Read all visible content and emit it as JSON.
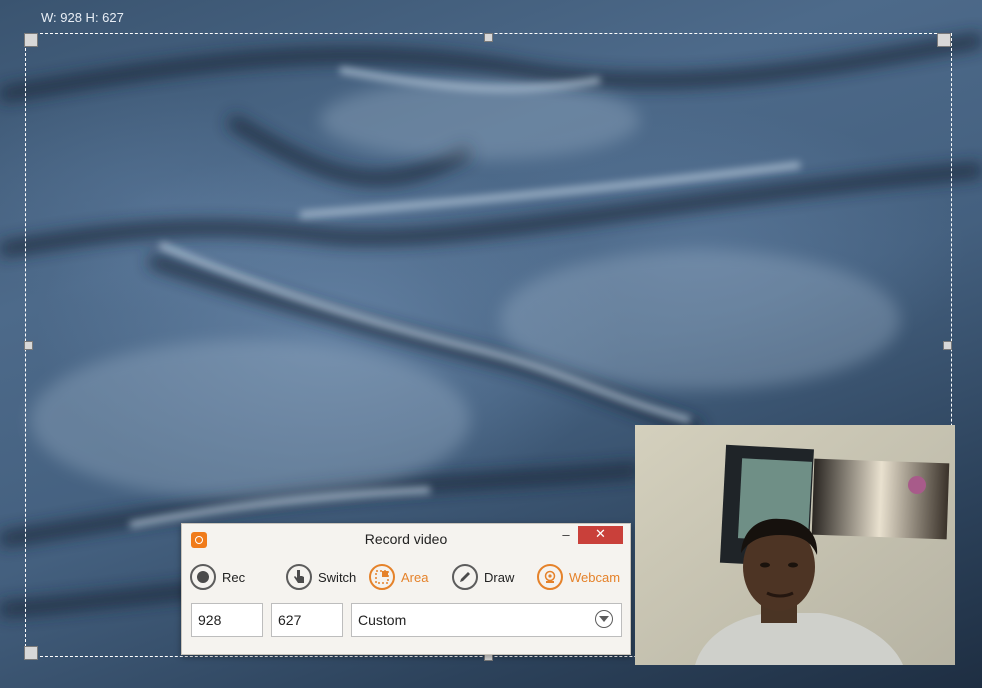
{
  "selection": {
    "dimensions_label": "W: 928 H: 627"
  },
  "dialog": {
    "title": "Record video",
    "minimize_label": "–",
    "close_label": "✕",
    "tools": [
      {
        "label": "Rec",
        "icon": "record-icon",
        "active": false
      },
      {
        "label": "Switch",
        "icon": "hand-pointer-icon",
        "active": false
      },
      {
        "label": "Area",
        "icon": "area-select-icon",
        "active": true
      },
      {
        "label": "Draw",
        "icon": "pencil-icon",
        "active": false
      },
      {
        "label": "Webcam",
        "icon": "webcam-icon",
        "active": true
      }
    ],
    "width_value": "928",
    "height_value": "627",
    "preset_value": "Custom"
  },
  "colors": {
    "accent": "#e5822a",
    "close": "#c9403a",
    "selection_border": "#ffffff"
  }
}
